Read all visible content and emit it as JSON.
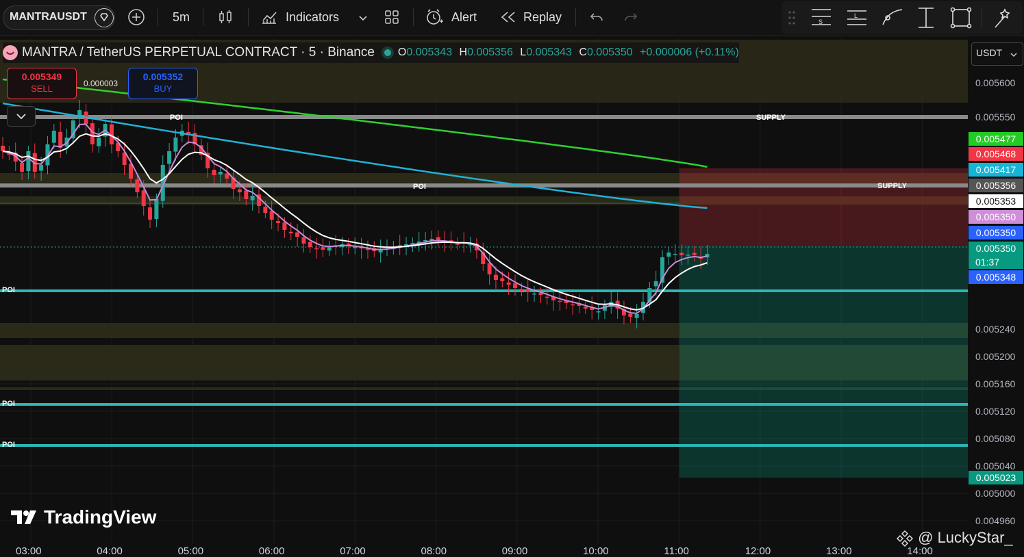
{
  "toolbar": {
    "symbol": "MANTRAUSDT",
    "interval": "5m",
    "indicators_label": "Indicators",
    "alert_label": "Alert",
    "replay_label": "Replay"
  },
  "legend": {
    "title": "MANTRA / TetherUS PERPETUAL CONTRACT · 5 · Binance",
    "o_label": "O",
    "o": "0.005343",
    "h_label": "H",
    "h": "0.005356",
    "l_label": "L",
    "l": "0.005343",
    "c_label": "C",
    "c": "0.005350",
    "change": "+0.000006 (+0.11%)"
  },
  "trade": {
    "sell_price": "0.005349",
    "sell_label": "SELL",
    "spread": "0.000003",
    "buy_price": "0.005352",
    "buy_label": "BUY"
  },
  "currency": "USDT",
  "price_axis": {
    "ticks": [
      "0.005600",
      "0.005550",
      "0.005240",
      "0.005200",
      "0.005160",
      "0.005120",
      "0.005080",
      "0.005040",
      "0.005000",
      "0.004960"
    ],
    "tags": [
      {
        "value": "0.005477",
        "bg": "#22cc22",
        "fg": "#ffffff"
      },
      {
        "value": "0.005468",
        "bg": "#f23645",
        "fg": "#ffffff"
      },
      {
        "value": "0.005417",
        "bg": "#16b5d6",
        "fg": "#ffffff"
      },
      {
        "value": "0.005356",
        "bg": "#555555",
        "fg": "#ffffff"
      },
      {
        "value": "0.005353",
        "bg": "#ffffff",
        "fg": "#111111"
      },
      {
        "value": "0.005350",
        "bg": "#cf8fd8",
        "fg": "#ffffff"
      },
      {
        "value": "0.005350",
        "bg": "#2962ff",
        "fg": "#ffffff"
      },
      {
        "value": "0.005350",
        "bg": "#089981",
        "fg": "#ffffff"
      },
      {
        "value": "0.005348",
        "bg": "#2962ff",
        "fg": "#ffffff"
      },
      {
        "value": "0.005023",
        "bg": "#089981",
        "fg": "#ffffff"
      }
    ],
    "countdown": "01:37"
  },
  "time_axis": [
    "03:00",
    "04:00",
    "05:00",
    "06:00",
    "07:00",
    "08:00",
    "09:00",
    "10:00",
    "11:00",
    "12:00",
    "13:00",
    "14:00"
  ],
  "zones": {
    "supply_label": "SUPPLY",
    "poi_label": "POI"
  },
  "watermark": "TradingView",
  "credit": "@ LuckyStar_",
  "colors": {
    "bullish": "#26a69a",
    "bearish": "#f23645",
    "ema_white": "#ffffff",
    "ema_violet": "#c68bd8",
    "ema_cyan": "#1fb3d6",
    "ema_green": "#2ed22e"
  },
  "chart_data": {
    "type": "candlestick",
    "interval": "5",
    "last_close": 0.00535,
    "close_series": [
      0.0055,
      0.005495,
      0.005485,
      0.00547,
      0.0055,
      0.00547,
      0.00548,
      0.00551,
      0.00553,
      0.005505,
      0.00552,
      0.005545,
      0.00556,
      0.00554,
      0.00551,
      0.00552,
      0.00554,
      0.00551,
      0.0055,
      0.00548,
      0.00546,
      0.00544,
      0.00542,
      0.0054,
      0.00543,
      0.00548,
      0.0055,
      0.00552,
      0.00553,
      0.005525,
      0.00551,
      0.005495,
      0.005475,
      0.005465,
      0.00547,
      0.00546,
      0.005445,
      0.00544,
      0.00543,
      0.005435,
      0.00542,
      0.00541,
      0.0054,
      0.005395,
      0.005385,
      0.00538,
      0.005375,
      0.005365,
      0.00536,
      0.005358,
      0.005356,
      0.00536,
      0.005362,
      0.005364,
      0.005362,
      0.00536,
      0.005358,
      0.005356,
      0.005354,
      0.005356,
      0.005358,
      0.00536,
      0.005362,
      0.005364,
      0.005366,
      0.005368,
      0.00537,
      0.005372,
      0.00537,
      0.005368,
      0.005366,
      0.005364,
      0.005366,
      0.005364,
      0.005355,
      0.005335,
      0.00532,
      0.005312,
      0.00531,
      0.005305,
      0.0053,
      0.005296,
      0.005294,
      0.005292,
      0.00529,
      0.005286,
      0.005282,
      0.00528,
      0.005278,
      0.005276,
      0.005274,
      0.00527,
      0.005268,
      0.005266,
      0.005275,
      0.00528,
      0.00527,
      0.00526,
      0.005258,
      0.005262,
      0.00528,
      0.0053,
      0.00531,
      0.005345,
      0.005352,
      0.00535,
      0.005348,
      0.005349,
      0.005348,
      0.005343,
      0.00535
    ]
  }
}
